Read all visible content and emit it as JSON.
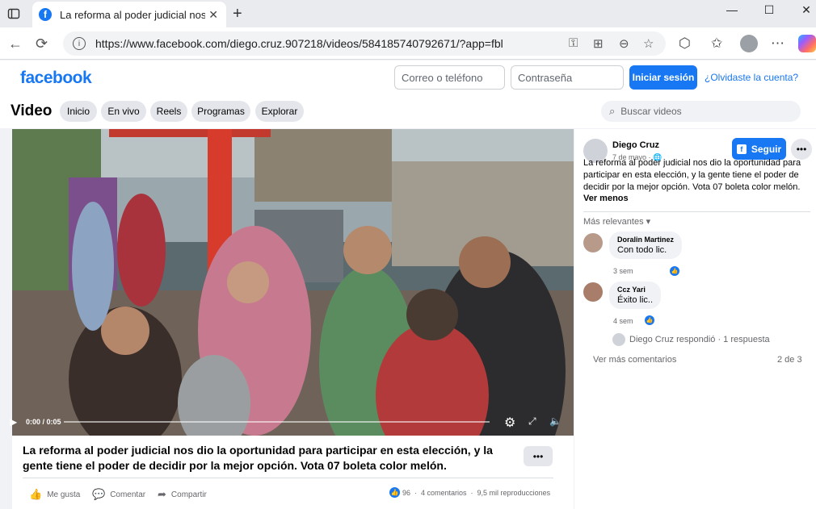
{
  "browser": {
    "tab_title": "La reforma al poder judicial nos d",
    "tab_close": "✕",
    "new_tab": "+",
    "url": "https://www.facebook.com/diego.cruz.907218/videos/584185740792671/?app=fbl",
    "win_min": "—",
    "win_max": "☐",
    "win_close": "✕"
  },
  "fb_header": {
    "logo": "facebook",
    "email_placeholder": "Correo o teléfono",
    "password_placeholder": "Contraseña",
    "login_label": "Iniciar sesión",
    "forgot_label": "¿Olvidaste la cuenta?"
  },
  "video_nav": {
    "title": "Video",
    "tabs": [
      "Inicio",
      "En vivo",
      "Reels",
      "Programas",
      "Explorar"
    ],
    "search_placeholder": "Buscar videos"
  },
  "player": {
    "time": "0:00 / 0:05",
    "progress_fraction": 0.0
  },
  "video_info": {
    "title": "La reforma al poder judicial nos dio la oportunidad para participar en esta elección, y la gente tiene el poder de decidir por la mejor opción. Vota 07 boleta color melón.",
    "more_label": "•••",
    "actions": [
      "Me gusta",
      "Comentar",
      "Compartir"
    ],
    "likes": "96",
    "comments": "4 comentarios",
    "views": "9,5 mil reproducciones"
  },
  "post": {
    "author": "Diego Cruz",
    "date": "7 de mayo · ",
    "follow_label": "Seguir",
    "more_label": "•••",
    "text": "La reforma al poder judicial nos dio la oportunidad para participar en esta elección, y la gente tiene el poder de decidir por la mejor opción. Vota 07 boleta color melón.",
    "see_less": "Ver menos",
    "sort_label": "Más relevantes ▾"
  },
  "comments": [
    {
      "name": "Doralin Martinez",
      "text": "Con todo lic.",
      "time": "3 sem"
    },
    {
      "name": "Ccz Yari",
      "text": "Éxito lic..",
      "time": "4 sem"
    }
  ],
  "reply_summary": "Diego Cruz respondió · 1 respuesta",
  "see_more_comments": "Ver más comentarios",
  "pager": "2 de 3",
  "colors": {
    "fb_blue": "#1877f2",
    "panel_bg": "#ffffff",
    "page_bg": "#f0f2f5"
  }
}
